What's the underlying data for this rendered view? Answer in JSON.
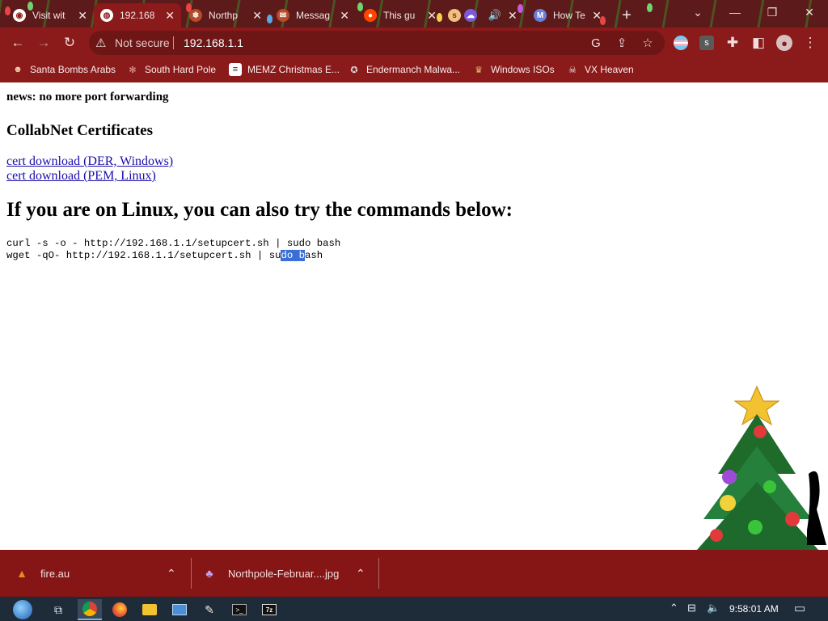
{
  "browser": {
    "tabs": [
      {
        "title": "Visit wit",
        "icon": "chrome-icon",
        "color": "#ffffff"
      },
      {
        "title": "192.168",
        "icon": "globe-icon",
        "color": "#ffffff"
      },
      {
        "title": "Northp",
        "icon": "northpole-icon",
        "color": "#b44b2a"
      },
      {
        "title": "Messag",
        "icon": "message-icon",
        "color": "#b44b2a"
      },
      {
        "title": "This gu",
        "icon": "reddit-icon",
        "color": "#ff4500"
      },
      {
        "title": "",
        "icon": "extension-icon",
        "color": "#f0c080"
      },
      {
        "title": "",
        "icon": "speaker-icon",
        "color": "#ffffff"
      },
      {
        "title": "How Te",
        "icon": "m-icon",
        "color": "#6c7fd8"
      }
    ],
    "new_tab_symbol": "+",
    "address": {
      "security_label": "Not secure",
      "url": "192.168.1.1"
    },
    "bookmarks": [
      {
        "label": "Santa Bombs Arabs",
        "icon": "person-icon"
      },
      {
        "label": "South Hard Pole",
        "icon": "snowflake-icon"
      },
      {
        "label": "MEMZ Christmas E...",
        "icon": "document-icon"
      },
      {
        "label": "Endermanch Malwa...",
        "icon": "raccoon-icon"
      },
      {
        "label": "Windows ISOs",
        "icon": "trophy-icon"
      },
      {
        "label": "VX Heaven",
        "icon": "skull-icon"
      }
    ]
  },
  "page": {
    "news": "news: no more port forwarding",
    "heading": "CollabNet Certificates",
    "links": [
      "cert download (DER, Windows)",
      "cert download (PEM, Linux)"
    ],
    "linux_heading": "If you are on Linux, you can also try the commands below:",
    "commands": {
      "curl": "curl -s -o - http://192.168.1.1/setupcert.sh | sudo bash",
      "wget_before": "wget -qO- http://192.168.1.1/setupcert.sh | su",
      "wget_selected": "do b",
      "wget_after": "ash"
    }
  },
  "downloads": [
    {
      "filename": "fire.au",
      "icon": "vlc-icon"
    },
    {
      "filename": "Northpole-Februar....jpg",
      "icon": "image-file-icon"
    }
  ],
  "taskbar": {
    "clock": "9:58:01 AM"
  }
}
